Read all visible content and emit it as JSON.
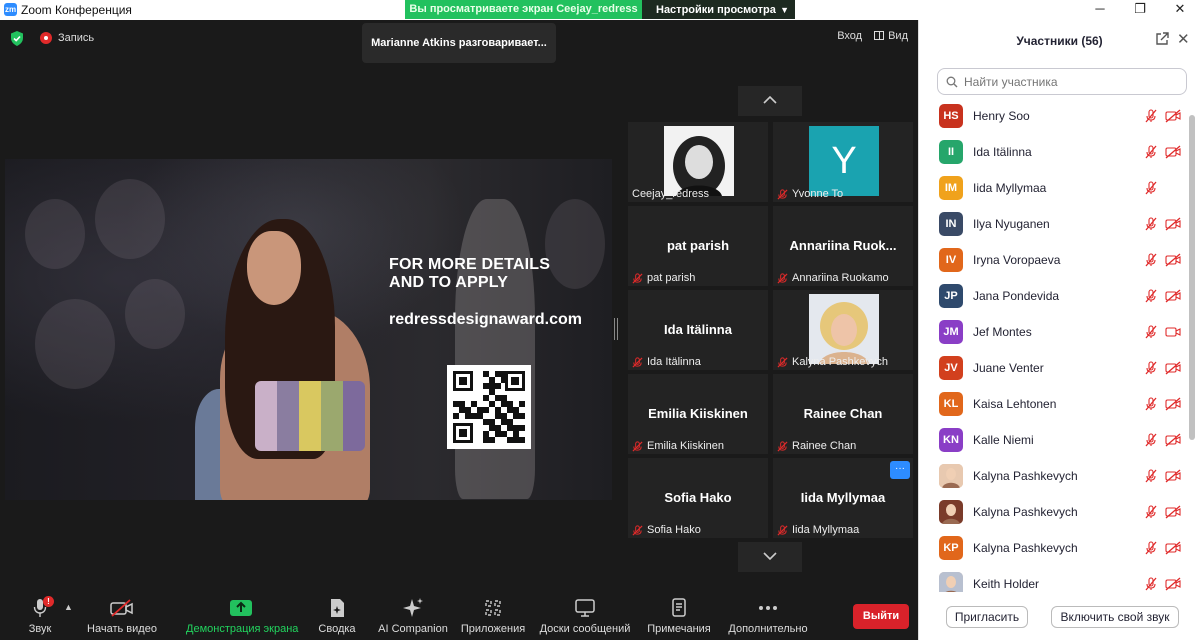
{
  "window": {
    "title": "Zoom Конференция",
    "logo": "zm",
    "minimize": "─",
    "maximize": "❐",
    "close": "✕"
  },
  "banner": {
    "message": "Вы просматриваете экран Ceejay_redress",
    "options_label": "Настройки просмотра"
  },
  "meeting": {
    "recording_label": "Запись",
    "speaking": "Marianne Atkins разговаривает...",
    "enter_label": "Вход",
    "view_label": "Вид"
  },
  "share": {
    "headline_line1": "FOR MORE DETAILS",
    "headline_line2": "AND TO APPLY",
    "url": "redressdesignaward.com"
  },
  "gallery": {
    "tiles": [
      {
        "name": "",
        "caption": "Ceejay_redress",
        "muted": false
      },
      {
        "name": "Y",
        "caption": "Yvonne To",
        "muted": true
      },
      {
        "name": "pat parish",
        "caption": "pat parish",
        "muted": true
      },
      {
        "name": "Annariina  Ruok...",
        "caption": "Annariina Ruokamo",
        "muted": true
      },
      {
        "name": "Ida Itälinna",
        "caption": "Ida Itälinna",
        "muted": true
      },
      {
        "name": "",
        "caption": "Kalyna Pashkevych",
        "muted": true
      },
      {
        "name": "Emilia Kiiskinen",
        "caption": "Emilia Kiiskinen",
        "muted": true
      },
      {
        "name": "Rainee Chan",
        "caption": "Rainee Chan",
        "muted": true
      },
      {
        "name": "Sofia Hako",
        "caption": "Sofia Hako",
        "muted": true
      },
      {
        "name": "Iida Myllymaa",
        "caption": "Iida Myllymaa",
        "muted": true
      }
    ],
    "more_label": "···"
  },
  "toolbar": {
    "audio": "Звук",
    "audio_badge": "!",
    "video": "Начать видео",
    "share": "Демонстрация экрана",
    "summary": "Сводка",
    "ai": "AI Companion",
    "apps": "Приложения",
    "whiteboards": "Доски сообщений",
    "notes": "Примечания",
    "more": "Дополнительно",
    "leave": "Выйти"
  },
  "participants": {
    "title": "Участники (56)",
    "search_placeholder": "Найти участника",
    "items": [
      {
        "initials": "HS",
        "name": "Henry Soo",
        "color": "#c8321e",
        "video": "off"
      },
      {
        "initials": "II",
        "name": "Ida Itälinna",
        "color": "#26a66b",
        "video": "off"
      },
      {
        "initials": "IM",
        "name": "Iida Myllymaa",
        "color": "#f0a21c",
        "video": "none"
      },
      {
        "initials": "IN",
        "name": "Ilya Nyuganen",
        "color": "#3a4a66",
        "video": "off"
      },
      {
        "initials": "IV",
        "name": "Iryna Voropaeva",
        "color": "#e1671b",
        "video": "off"
      },
      {
        "initials": "JP",
        "name": "Jana Pondevida",
        "color": "#2f4a6d",
        "video": "off"
      },
      {
        "initials": "JM",
        "name": "Jef Montes",
        "color": "#8a3ec6",
        "video": "on"
      },
      {
        "initials": "JV",
        "name": "Juane Venter",
        "color": "#d2401e",
        "video": "off"
      },
      {
        "initials": "KL",
        "name": "Kaisa Lehtonen",
        "color": "#e1671b",
        "video": "off"
      },
      {
        "initials": "KN",
        "name": "Kalle Niemi",
        "color": "#8a3ec6",
        "video": "off"
      },
      {
        "initials": "",
        "name": "Kalyna Pashkevych",
        "color": "#e8c9b0",
        "video": "off"
      },
      {
        "initials": "",
        "name": "Kalyna Pashkevych",
        "color": "#7a3b2a",
        "video": "off"
      },
      {
        "initials": "KP",
        "name": "Kalyna Pashkevych",
        "color": "#e1671b",
        "video": "off"
      },
      {
        "initials": "",
        "name": "Keith Holder",
        "color": "#b8c0d0",
        "video": "off"
      }
    ],
    "invite_label": "Пригласить",
    "unmute_label": "Включить свой звук"
  },
  "colors": {
    "accent_green": "#22c15e",
    "leave_red": "#d9222a",
    "mute_red": "#e02a2a",
    "blue": "#2d8cff"
  }
}
